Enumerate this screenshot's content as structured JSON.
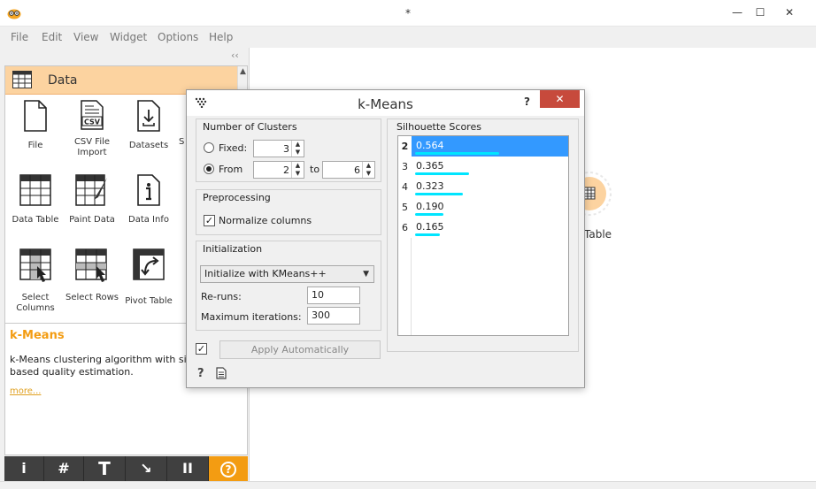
{
  "window": {
    "title": "*",
    "minimize": "—",
    "maximize": "☐",
    "close": "✕"
  },
  "menu": [
    "File",
    "Edit",
    "View",
    "Widget",
    "Options",
    "Help"
  ],
  "dock": {
    "collapse_glyph": "‹‹",
    "category": "Data",
    "widgets": [
      {
        "label": "File",
        "icon": "file-icon"
      },
      {
        "label": "CSV File Import",
        "icon": "csv-icon"
      },
      {
        "label": "Datasets",
        "icon": "datasets-icon"
      },
      {
        "label": "S",
        "icon": "sql-icon"
      },
      {
        "label": "Data Table",
        "icon": "data-table-icon"
      },
      {
        "label": "Paint Data",
        "icon": "paint-data-icon"
      },
      {
        "label": "Data Info",
        "icon": "data-info-icon"
      },
      {
        "label": "Select Columns",
        "icon": "select-columns-icon"
      },
      {
        "label": "Select Rows",
        "icon": "select-rows-icon"
      },
      {
        "label": "Pivot Table",
        "icon": "pivot-table-icon"
      }
    ],
    "description": {
      "title": "k-Means",
      "text": "k-Means clustering algorithm with silhouette-based quality estimation.",
      "more": "more..."
    },
    "toolbar": [
      "i",
      "#",
      "T",
      "↘",
      "II",
      "?"
    ]
  },
  "canvas": {
    "node_label": "Table"
  },
  "dialog": {
    "title": "k-Means",
    "help": "?",
    "close": "✕",
    "clusters": {
      "title": "Number of Clusters",
      "fixed_label": "Fixed:",
      "fixed_value": "3",
      "from_label": "From",
      "from_value": "2",
      "to_label": "to",
      "to_value": "6",
      "selected": "from"
    },
    "preprocessing": {
      "title": "Preprocessing",
      "normalize_label": "Normalize columns",
      "normalize_checked": true
    },
    "initialization": {
      "title": "Initialization",
      "method": "Initialize with KMeans++",
      "reruns_label": "Re-runs:",
      "reruns_value": "10",
      "maxiter_label": "Maximum iterations:",
      "maxiter_value": "300"
    },
    "apply": {
      "checked": true,
      "label": "Apply Automatically"
    },
    "silhouette": {
      "title": "Silhouette Scores",
      "rows": [
        {
          "k": "2",
          "score": "0.564",
          "value": 0.564,
          "selected": true
        },
        {
          "k": "3",
          "score": "0.365",
          "value": 0.365,
          "selected": false
        },
        {
          "k": "4",
          "score": "0.323",
          "value": 0.323,
          "selected": false
        },
        {
          "k": "5",
          "score": "0.190",
          "value": 0.19,
          "selected": false
        },
        {
          "k": "6",
          "score": "0.165",
          "value": 0.165,
          "selected": false
        }
      ]
    }
  }
}
